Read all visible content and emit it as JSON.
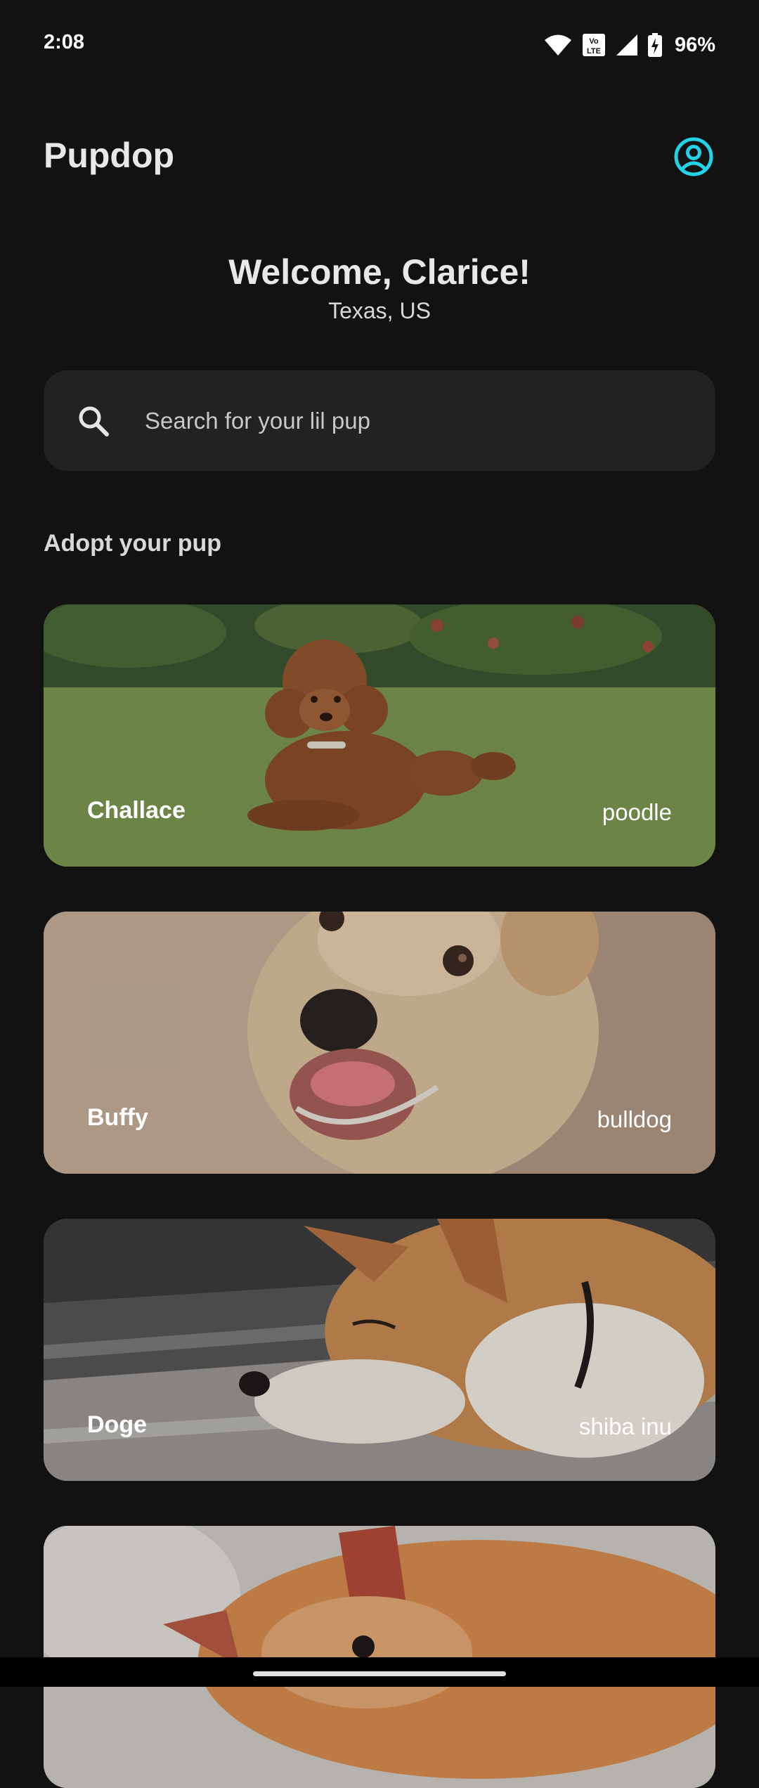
{
  "status_bar": {
    "time": "2:08",
    "battery": "96%",
    "icons": [
      "wifi-icon",
      "volte-icon",
      "cell-signal-icon",
      "battery-charging-icon"
    ],
    "volte_label": "Vo LTE"
  },
  "app": {
    "title": "Pupdop",
    "profile_icon": "account-circle-icon",
    "accent": "#22d3e6"
  },
  "welcome": {
    "title": "Welcome, Clarice!",
    "location": "Texas, US"
  },
  "search": {
    "placeholder": "Search for your lil pup",
    "value": ""
  },
  "section": {
    "heading": "Adopt your pup"
  },
  "pups": [
    {
      "name": "Challace",
      "breed": "poodle"
    },
    {
      "name": "Buffy",
      "breed": "bulldog"
    },
    {
      "name": "Doge",
      "breed": "shiba inu"
    },
    {
      "name": "",
      "breed": ""
    }
  ],
  "colors": {
    "background": "#121212",
    "surface": "#222222"
  }
}
